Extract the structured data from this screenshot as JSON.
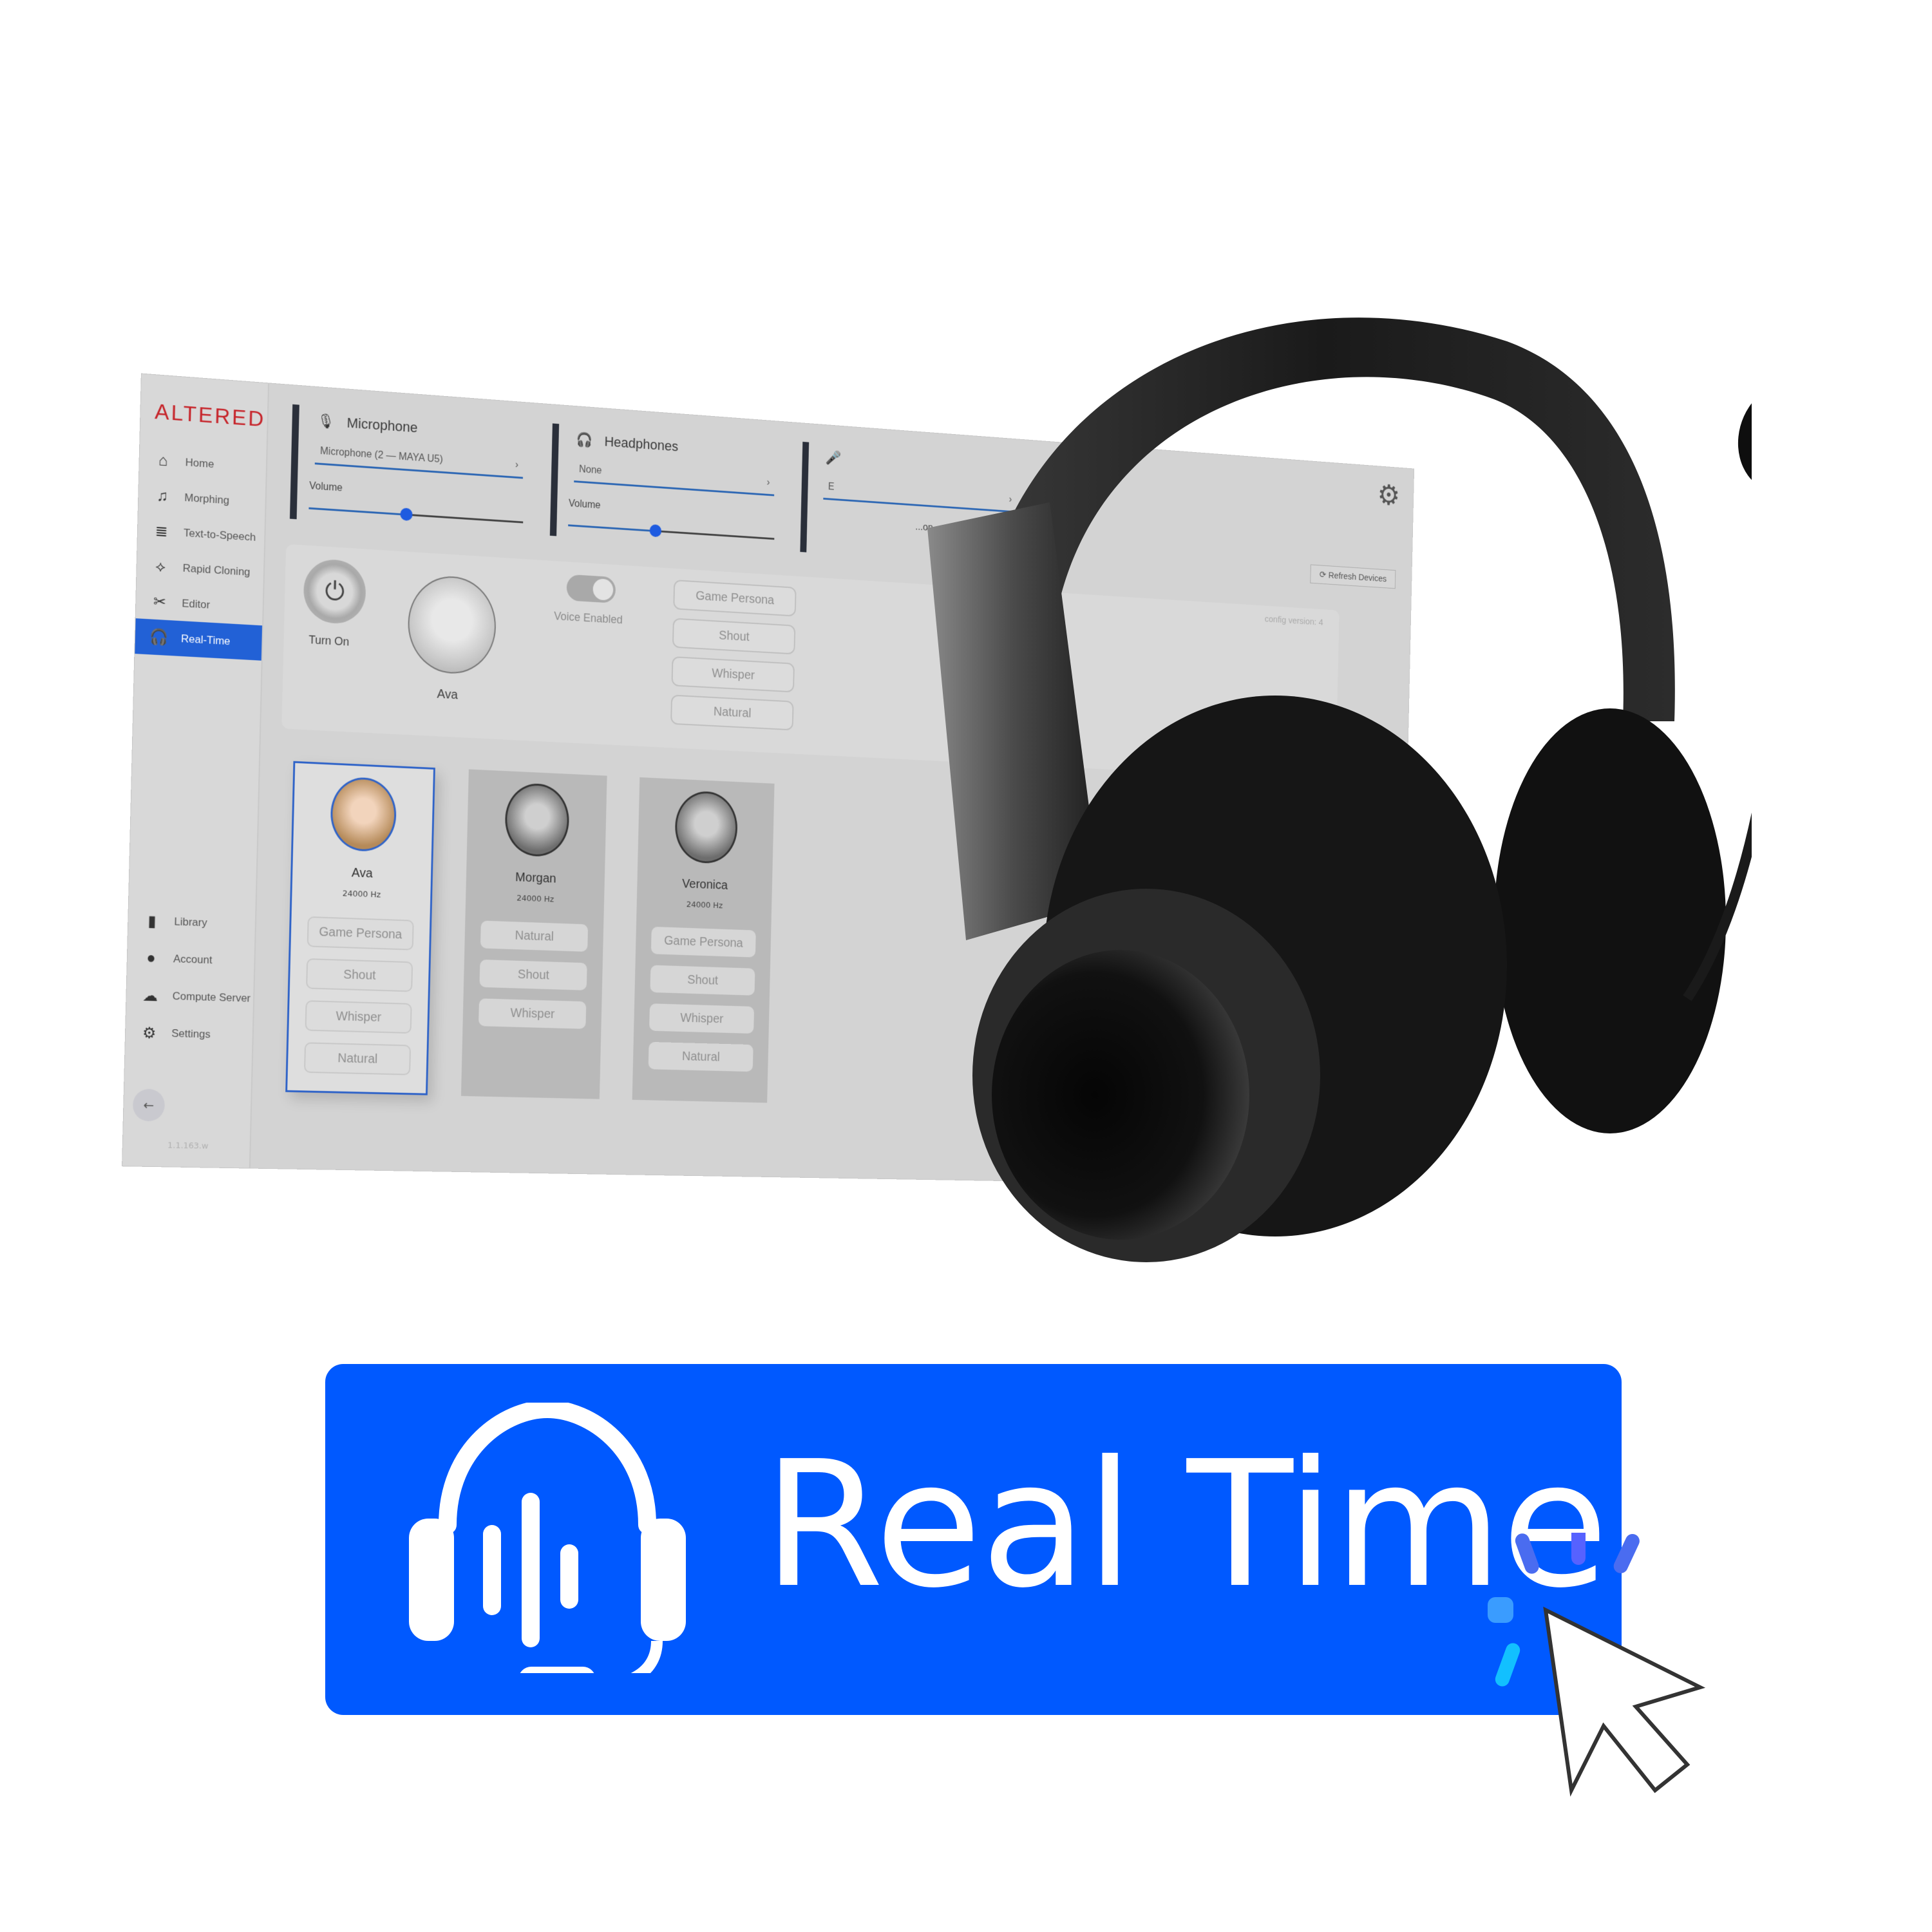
{
  "app": {
    "brand": "ALTERED",
    "sidebar": {
      "items": [
        {
          "label": "Home",
          "icon": "home-icon"
        },
        {
          "label": "Morphing",
          "icon": "morphing-icon"
        },
        {
          "label": "Text-to-Speech",
          "icon": "text-to-speech-icon"
        },
        {
          "label": "Rapid Cloning",
          "icon": "dna-icon"
        },
        {
          "label": "Editor",
          "icon": "editor-icon"
        },
        {
          "label": "Real-Time",
          "icon": "headset-icon",
          "active": true
        }
      ],
      "bottom_items": [
        {
          "label": "Library",
          "icon": "book-icon"
        },
        {
          "label": "Account",
          "icon": "user-icon"
        },
        {
          "label": "Compute Server",
          "icon": "cloud-icon"
        },
        {
          "label": "Settings",
          "icon": "gear-icon"
        }
      ],
      "back_label": "←",
      "version": "1.1.163.w"
    },
    "devices": {
      "microphone": {
        "title": "Microphone",
        "icon": "microphone-icon",
        "selected": "Microphone (2 — MAYA U5)",
        "volume_label": "Volume",
        "volume": 0.45
      },
      "headphones": {
        "title": "Headphones",
        "icon": "headphones-icon",
        "selected": "None",
        "volume_label": "Volume",
        "volume": 0.42
      },
      "third": {
        "icon": "voice-mic-icon",
        "selected": "E",
        "note": "...on."
      }
    },
    "refresh_label": "Refresh Devices",
    "settings_icon": "gear-icon",
    "control_panel": {
      "power_label": "Turn On",
      "active_voice": "Ava",
      "toggle_label": "Voice Enabled",
      "toggle_on": true,
      "styles": [
        "Game Persona",
        "Shout",
        "Whisper",
        "Natural"
      ],
      "config_version": "config version: 4"
    },
    "voices": [
      {
        "name": "Ava",
        "rate": "24000 Hz",
        "styles": [
          "Game Persona",
          "Shout",
          "Whisper",
          "Natural"
        ],
        "selected": true
      },
      {
        "name": "Morgan",
        "rate": "24000 Hz",
        "styles": [
          "Natural",
          "Shout",
          "Whisper"
        ],
        "selected": false
      },
      {
        "name": "Veronica",
        "rate": "24000 Hz",
        "styles": [
          "Game Persona",
          "Shout",
          "Whisper",
          "Natural"
        ],
        "selected": false
      }
    ]
  },
  "banner": {
    "label": "Real Time",
    "icon": "headset-waveform-icon",
    "color": "#0059ff"
  },
  "colors": {
    "brand_red": "#c6242a",
    "accent_blue": "#2261d6"
  }
}
